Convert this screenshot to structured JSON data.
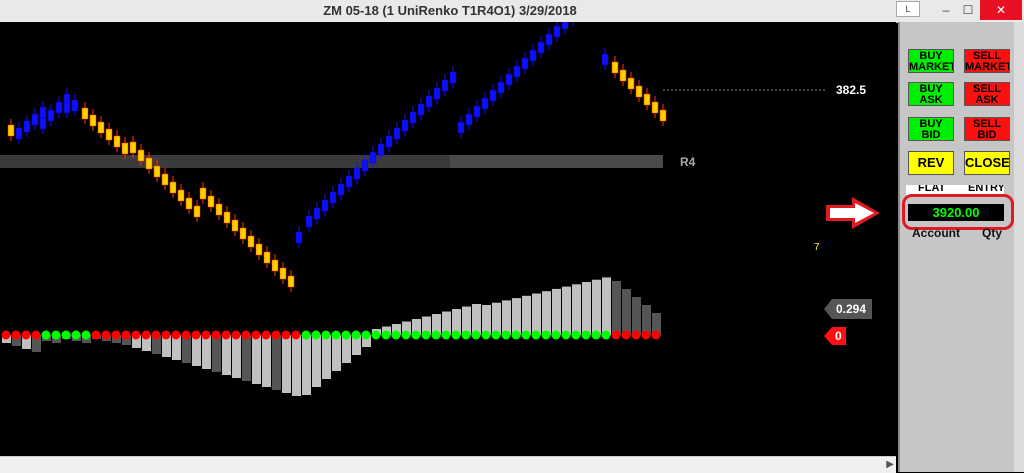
{
  "window": {
    "title": "ZM 05-18 (1 UniRenko T1R4O1)  3/29/2018"
  },
  "controls": {
    "minimize": "–",
    "maximize": "☐",
    "close": "✕",
    "box_label": "L"
  },
  "panel": {
    "buy_market": "BUY MARKET",
    "sell_market": "SELL MARKET",
    "buy_ask": "BUY ASK",
    "sell_ask": "SELL ASK",
    "buy_bid": "BUY BID",
    "sell_bid": "SELL BID",
    "rev": "REV",
    "close": "CLOSE",
    "flat_label": "FLAT",
    "entry_label": "ENTRY",
    "entry_price": "3920.00",
    "account_label": "Account",
    "qty_label": "Qty"
  },
  "chart": {
    "price_label": "382.5",
    "level_label": "R4",
    "marker_value": "7",
    "oscillator_value": "0.294",
    "signal_value": "0"
  },
  "colors": {
    "up_candle": "#1010ff",
    "down_candle": "#ffd000",
    "down_candle_edge": "#ff3300",
    "hist_light": "#c0c0c0",
    "hist_dark": "#555555",
    "dot_green": "#00ff00",
    "dot_red": "#ff0000",
    "buy": "#00ee00",
    "sell": "#ff1010",
    "highlight_ring": "#e01a22"
  },
  "arrow": {
    "icon": "right-arrow-icon"
  }
}
